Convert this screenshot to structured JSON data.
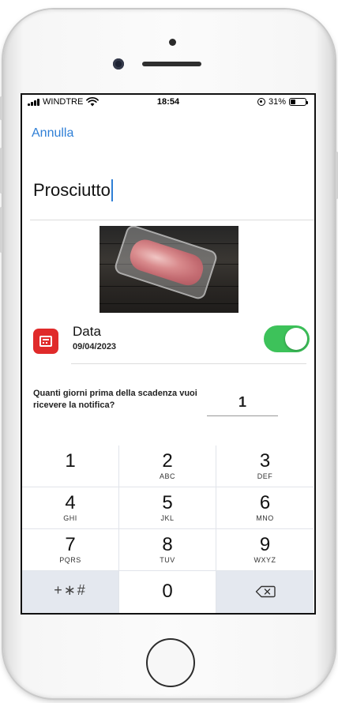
{
  "status_bar": {
    "carrier": "WINDTRE",
    "time": "18:54",
    "battery": "31%",
    "battery_level": 0.31
  },
  "nav": {
    "cancel_label": "Annulla"
  },
  "product": {
    "name": "Prosciutto"
  },
  "date_row": {
    "title": "Data",
    "value": "09/04/2023",
    "toggle_on": true,
    "toggle_color": "#3dc25a",
    "icon": "calendar-icon",
    "icon_bg": "#e02a2a"
  },
  "notification": {
    "question": "Quanti giorni prima della scadenza vuoi ricevere la notifica?",
    "days_value": "1"
  },
  "keypad": {
    "keys": [
      {
        "digit": "1",
        "letters": ""
      },
      {
        "digit": "2",
        "letters": "ABC"
      },
      {
        "digit": "3",
        "letters": "DEF"
      },
      {
        "digit": "4",
        "letters": "GHI"
      },
      {
        "digit": "5",
        "letters": "JKL"
      },
      {
        "digit": "6",
        "letters": "MNO"
      },
      {
        "digit": "7",
        "letters": "PQRS"
      },
      {
        "digit": "8",
        "letters": "TUV"
      },
      {
        "digit": "9",
        "letters": "WXYZ"
      }
    ],
    "symbols_label": "+∗#",
    "zero": "0",
    "backspace_icon": "backspace-icon"
  },
  "colors": {
    "accent": "#2f7fd6",
    "keypad_dark": "#e4e8ef"
  }
}
